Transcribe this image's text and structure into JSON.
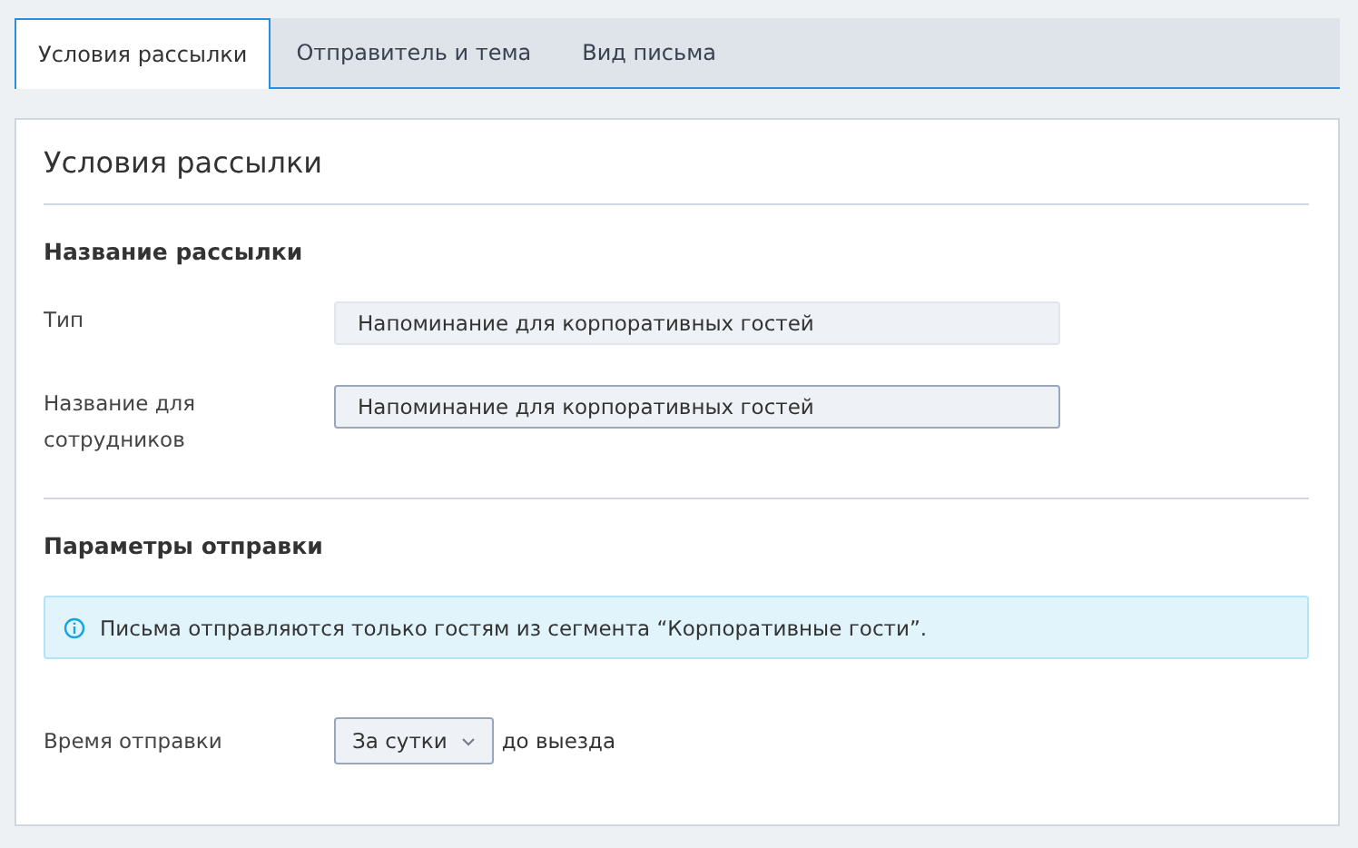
{
  "tabs": [
    {
      "label": "Условия рассылки",
      "selected": true
    },
    {
      "label": "Отправитель и тема",
      "selected": false
    },
    {
      "label": "Вид письма",
      "selected": false
    }
  ],
  "panel": {
    "title": "Условия рассылки",
    "sections": [
      {
        "heading": "Название рассылки",
        "items": [
          {
            "kind": "field",
            "label": "Тип",
            "value": "Напоминание для корпоративных гостей",
            "disabled": true
          },
          {
            "kind": "field",
            "label": "Название для сотрудников",
            "value": "Напоминание для корпоративных гостей",
            "disabled": false
          }
        ]
      },
      {
        "heading": "Параметры отправки",
        "items": [
          {
            "kind": "info",
            "text": "Письма отправляются только гостям из сегмента “Корпоративные гости”."
          },
          {
            "kind": "select",
            "label": "Время отправки",
            "value": "За сутки",
            "suffix": "до выезда"
          }
        ]
      }
    ]
  }
}
